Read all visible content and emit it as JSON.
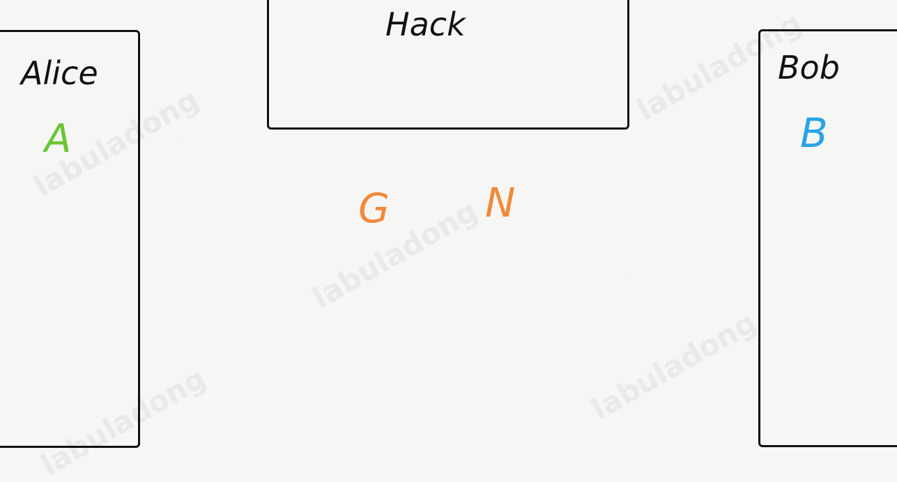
{
  "parties": {
    "alice": {
      "label": "Alice",
      "key": "A",
      "key_color": "#6cc531"
    },
    "hack": {
      "label": "Hack"
    },
    "bob": {
      "label": "Bob",
      "key": "B",
      "key_color": "#27a4e8"
    }
  },
  "public_params": {
    "g": "G",
    "n": "N",
    "color": "#f08a3a"
  },
  "watermark": "labuladong",
  "colors": {
    "stroke": "#111111",
    "background": "#f6f6f4"
  }
}
